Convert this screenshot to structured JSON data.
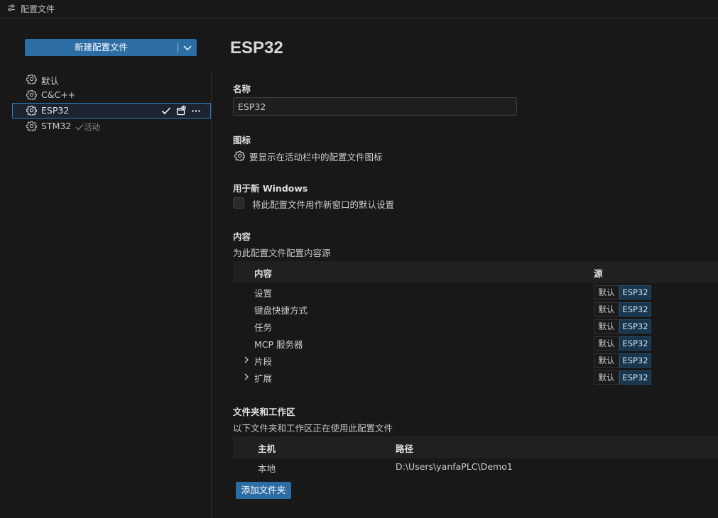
{
  "titlebar": {
    "title": "配置文件",
    "icon": "settings-sliders-icon"
  },
  "sidebar": {
    "new_button_label": "新建配置文件",
    "profiles": [
      {
        "name": "默认",
        "icon": "gear-icon"
      },
      {
        "name": "C&C++",
        "icon": "gear-icon"
      },
      {
        "name": "ESP32",
        "icon": "gear-icon",
        "selected": true
      },
      {
        "name": "STM32",
        "icon": "gear-icon",
        "active_label": "活动"
      }
    ]
  },
  "main": {
    "title": "ESP32",
    "name_section": {
      "label": "名称",
      "value": "ESP32"
    },
    "icon_section": {
      "label": "图标",
      "text": "要显示在活动栏中的配置文件图标"
    },
    "new_windows_section": {
      "label": "用于新 Windows",
      "checkbox_label": "将此配置文件用作新窗口的默认设置",
      "checked": false
    },
    "contents_section": {
      "label": "内容",
      "description": "为此配置文件配置内容源",
      "columns": {
        "content": "内容",
        "source": "源"
      },
      "rows": [
        {
          "label": "设置",
          "expandable": false,
          "source_default": "默认",
          "source_profile": "ESP32"
        },
        {
          "label": "键盘快捷方式",
          "expandable": false,
          "source_default": "默认",
          "source_profile": "ESP32"
        },
        {
          "label": "任务",
          "expandable": false,
          "source_default": "默认",
          "source_profile": "ESP32"
        },
        {
          "label": "MCP 服务器",
          "expandable": false,
          "source_default": "默认",
          "source_profile": "ESP32"
        },
        {
          "label": "片段",
          "expandable": true,
          "source_default": "默认",
          "source_profile": "ESP32"
        },
        {
          "label": "扩展",
          "expandable": true,
          "source_default": "默认",
          "source_profile": "ESP32"
        }
      ]
    },
    "folders_section": {
      "label": "文件夹和工作区",
      "description": "以下文件夹和工作区正在使用此配置文件",
      "columns": {
        "host": "主机",
        "path": "路径"
      },
      "rows": [
        {
          "host": "本地",
          "path": "D:\\Users\\yanfaPLC\\Demo1"
        }
      ],
      "add_button_label": "添加文件夹"
    }
  },
  "colors": {
    "accent": "#2c6da4",
    "background": "#181818",
    "selection_border": "#2f7dbd"
  }
}
